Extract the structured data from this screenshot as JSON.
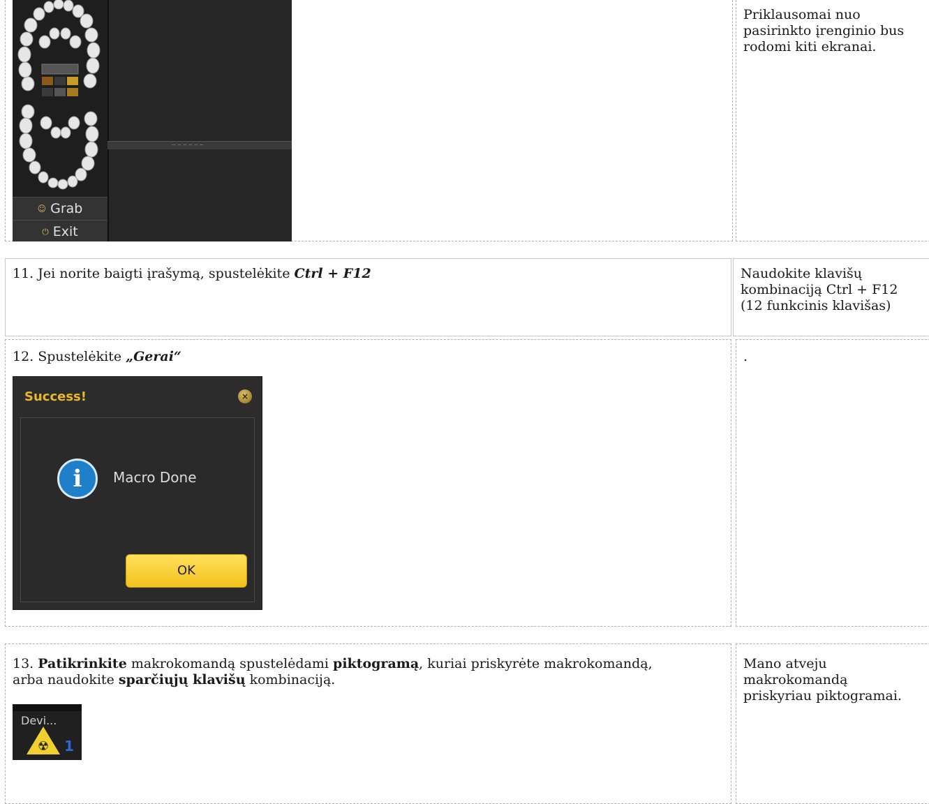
{
  "row1": {
    "grab_label": "Grab",
    "exit_label": "Exit",
    "side_note": "Priklausomai nuo pasirinkto įrenginio bus rodomi kiti ekranai."
  },
  "row2": {
    "text_prefix": "11. Jei norite baigti įrašymą, spustelėkite ",
    "text_emph": "Ctrl + F12",
    "side_note": "Naudokite klavišų kombinaciją Ctrl + F12 (12 funkcinis klavišas)"
  },
  "row3": {
    "text_prefix": "12. Spustelėkite ",
    "text_emph": "„Gerai“",
    "side_note": ".",
    "dialog": {
      "title": "Success!",
      "message": "Macro Done",
      "ok_label": "OK"
    }
  },
  "row4": {
    "num": "13. ",
    "b1": "Patikrinkite",
    "t1": " makrokomandą spustelėdami ",
    "b2": "piktogramą",
    "t2": ", kuriai priskyrėte makrokomandą, arba naudokite ",
    "b3": "sparčiųjų klavišų",
    "t3": " kombinaciją.",
    "device_label": "Devi...",
    "side_note": "Mano atveju makrokomandą priskyriau piktogramai."
  }
}
